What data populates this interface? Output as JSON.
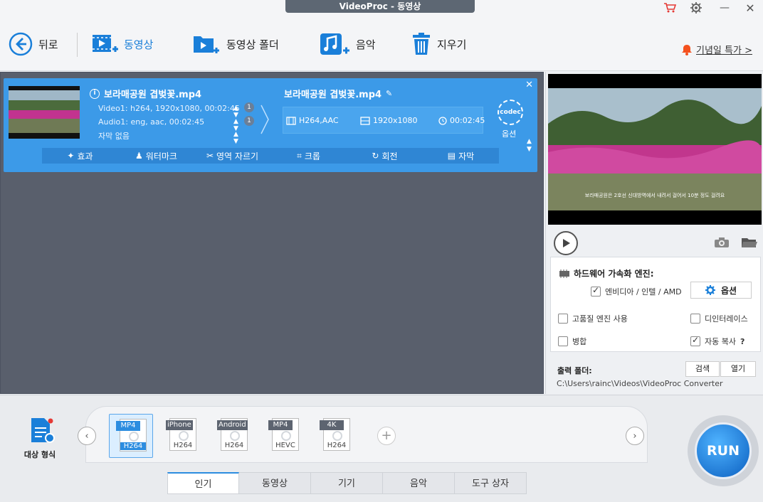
{
  "window": {
    "title": "VideoProc - 동영상"
  },
  "toolbar": {
    "back": "뒤로",
    "video": "동영상",
    "video_folder": "동영상 폴더",
    "music": "음악",
    "clear": "지우기",
    "promo": "기념일 특가 >"
  },
  "file": {
    "source_name": "보라매공원 겹벚꽃.mp4",
    "video_info": "Video1: h264, 1920x1080, 00:02:45",
    "audio_info": "Audio1: eng, aac, 00:02:45",
    "subtitle_info": "자막 없음",
    "video_track_count": "1",
    "audio_track_count": "1",
    "output_name": "보라매공원 겹벚꽃.mp4",
    "out_codec": "H264,AAC",
    "out_resolution": "1920x1080",
    "out_duration": "00:02:45",
    "codec_badge": "codec",
    "codec_label": "옵션",
    "actions": [
      "효과",
      "워터마크",
      "영역 자르기",
      "크롭",
      "회전",
      "자막"
    ]
  },
  "preview": {
    "caption": "보라매공원은 2호선 신대방역에서 내려서 걸어서 10분 정도 걸려요"
  },
  "hw": {
    "title": "하드웨어 가속화 엔진:",
    "vendor": "엔비디아 / 인텔 / AMD",
    "vendor_checked": true,
    "options_btn": "옵션",
    "hq_engine": "고품질 엔진 사용",
    "deinterlace": "디인터레이스",
    "merge": "병합",
    "autocopy": "자동 복사",
    "autocopy_help": "?"
  },
  "output": {
    "label": "출력 폴더:",
    "browse": "검색",
    "open": "열기",
    "path": "C:\\Users\\rainc\\Videos\\VideoProc Converter"
  },
  "target": {
    "label": "대상 형식"
  },
  "presets": [
    {
      "tag": "MP4",
      "sub": "H264",
      "selected": true
    },
    {
      "tag": "iPhone",
      "sub": "H264",
      "selected": false
    },
    {
      "tag": "Android",
      "sub": "H264",
      "selected": false
    },
    {
      "tag": "MP4",
      "sub": "HEVC",
      "selected": false
    },
    {
      "tag": "4K",
      "sub": "H264",
      "selected": false
    }
  ],
  "tabs": [
    "인기",
    "동영상",
    "기기",
    "음악",
    "도구 상자"
  ],
  "run_label": "RUN",
  "colors": {
    "accent": "#3c9ae8",
    "run": "#0b5fc0",
    "cart": "#e53935"
  }
}
